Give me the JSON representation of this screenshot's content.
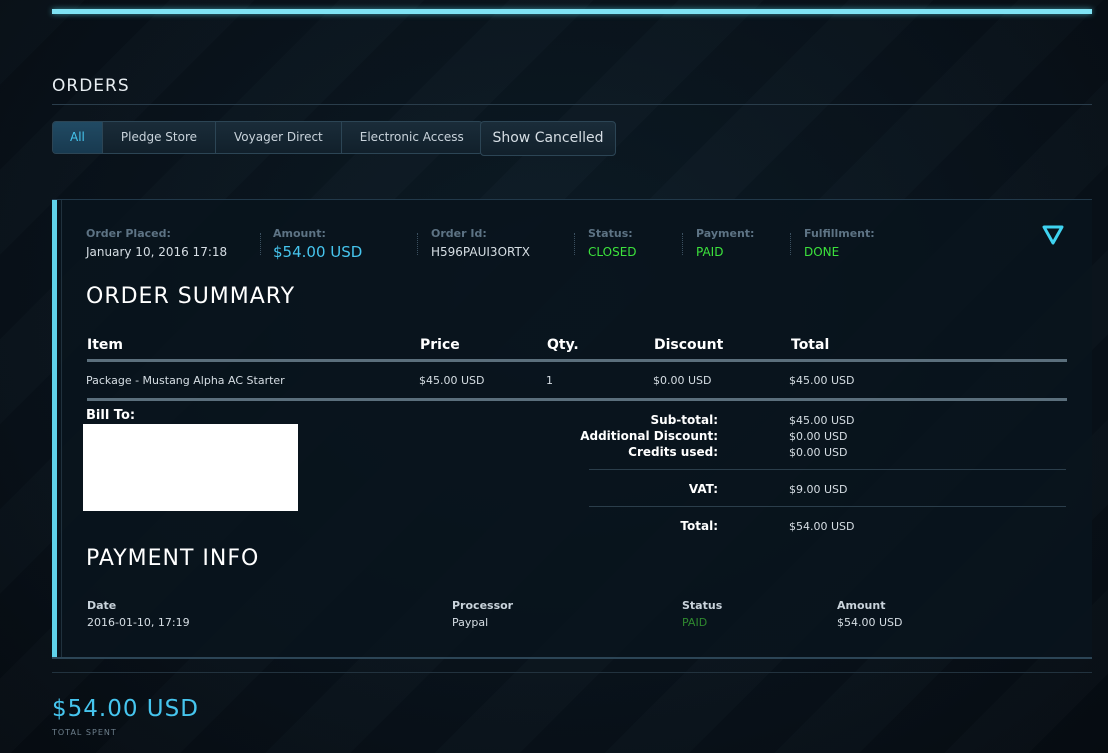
{
  "orders": {
    "title": "ORDERS"
  },
  "filters": {
    "tabs": [
      "All",
      "Pledge Store",
      "Voyager Direct",
      "Electronic Access"
    ],
    "show_cancelled": "Show Cancelled"
  },
  "order": {
    "meta": {
      "placed_label": "Order Placed:",
      "placed": "January 10, 2016 17:18",
      "amount_label": "Amount:",
      "amount": "$54.00 USD",
      "id_label": "Order Id:",
      "id": "H596PAUI3ORTX",
      "status_label": "Status:",
      "status": "CLOSED",
      "payment_label": "Payment:",
      "payment": "PAID",
      "fulfillment_label": "Fulfillment:",
      "fulfillment": "DONE"
    },
    "summary_title": "ORDER SUMMARY",
    "columns": [
      "Item",
      "Price",
      "Qty.",
      "Discount",
      "Total"
    ],
    "items": [
      {
        "item": "Package - Mustang Alpha AC Starter",
        "price": "$45.00 USD",
        "qty": "1",
        "discount": "$0.00 USD",
        "total": "$45.00 USD"
      }
    ],
    "bill_to_label": "Bill To:",
    "totals": {
      "subtotal_label": "Sub-total:",
      "subtotal": "$45.00 USD",
      "discount_label": "Additional Discount:",
      "discount": "$0.00 USD",
      "credits_label": "Credits used:",
      "credits": "$0.00 USD",
      "vat_label": "VAT:",
      "vat": "$9.00 USD",
      "total_label": "Total:",
      "total": "$54.00 USD"
    },
    "payment_title": "PAYMENT INFO",
    "payment_columns": [
      "Date",
      "Processor",
      "Status",
      "Amount"
    ],
    "payments": [
      {
        "date": "2016-01-10, 17:19",
        "processor": "Paypal",
        "status": "PAID",
        "amount": "$54.00 USD"
      }
    ]
  },
  "summary": {
    "total_spent": "$54.00 USD",
    "total_spent_label": "TOTAL SPENT"
  },
  "colors": {
    "accent": "#46c5ee",
    "status_green": "#3ce23c",
    "top_bar": "#7fe3f4"
  },
  "icons": {
    "toggle": "triangle-down-icon"
  }
}
